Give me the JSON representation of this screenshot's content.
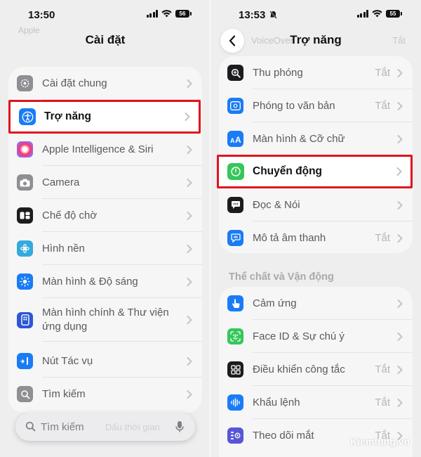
{
  "left": {
    "status": {
      "time": "13:50",
      "battery": "56"
    },
    "title": "Cài đặt",
    "ghost_top": "Apple",
    "items": [
      {
        "label": "Cài đặt chung",
        "icon": "gear-icon",
        "color": "#8e8e93"
      },
      {
        "label": "Trợ năng",
        "icon": "accessibility-icon",
        "color": "#1a7cf5"
      },
      {
        "label": "Apple Intelligence & Siri",
        "icon": "apple-intelligence-icon",
        "color": "#c45ad0"
      },
      {
        "label": "Camera",
        "icon": "camera-icon",
        "color": "#8e8e93"
      },
      {
        "label": "Chế độ chờ",
        "icon": "standby-icon",
        "color": "#1c1c1e"
      },
      {
        "label": "Hình nền",
        "icon": "wallpaper-icon",
        "color": "#34aadc"
      },
      {
        "label": "Màn hình & Độ sáng",
        "icon": "brightness-icon",
        "color": "#1a7cf5"
      },
      {
        "label": "Màn hình chính & Thư viện ứng dụng",
        "icon": "home-screen-icon",
        "color": "#2d55d6"
      },
      {
        "label": "Nút Tác vụ",
        "icon": "action-button-icon",
        "color": "#1a7cf5"
      },
      {
        "label": "Tìm kiếm",
        "icon": "search-icon",
        "color": "#8e8e93"
      }
    ],
    "search": {
      "placeholder": "Tìm kiếm",
      "ghost": "Dấu thời gian"
    }
  },
  "right": {
    "status": {
      "time": "13:53",
      "battery": "55"
    },
    "title": "Trợ năng",
    "ghost_top": "VoiceOver",
    "ghost_value": "Tắt",
    "group1": [
      {
        "label": "Thu phóng",
        "value": "Tắt",
        "icon": "zoom-icon",
        "color": "#1c1c1e"
      },
      {
        "label": "Phóng to văn bản",
        "value": "Tắt",
        "icon": "text-magnify-icon",
        "color": "#1a7cf5"
      },
      {
        "label": "Màn hình & Cỡ chữ",
        "value": "",
        "icon": "text-size-icon",
        "color": "#1a7cf5"
      },
      {
        "label": "Chuyển động",
        "value": "",
        "icon": "motion-icon",
        "color": "#34c759"
      },
      {
        "label": "Đọc & Nói",
        "value": "",
        "icon": "speech-icon",
        "color": "#1c1c1e"
      },
      {
        "label": "Mô tả âm thanh",
        "value": "Tắt",
        "icon": "audio-description-icon",
        "color": "#1a7cf5"
      }
    ],
    "section_header": "Thể chất và Vận động",
    "group2": [
      {
        "label": "Cảm ứng",
        "value": "",
        "icon": "touch-icon",
        "color": "#1a7cf5"
      },
      {
        "label": "Face ID & Sự chú ý",
        "value": "",
        "icon": "face-id-icon",
        "color": "#34c759"
      },
      {
        "label": "Điều khiển công tắc",
        "value": "Tắt",
        "icon": "switch-control-icon",
        "color": "#1c1c1e"
      },
      {
        "label": "Khẩu lệnh",
        "value": "Tắt",
        "icon": "voice-control-icon",
        "color": "#1a7cf5"
      },
      {
        "label": "Theo dõi mắt",
        "value": "Tắt",
        "icon": "eye-tracking-icon",
        "color": "#5856d6"
      }
    ]
  },
  "watermark": "Kiemtung.vn",
  "highlight_color": "#e0141e"
}
